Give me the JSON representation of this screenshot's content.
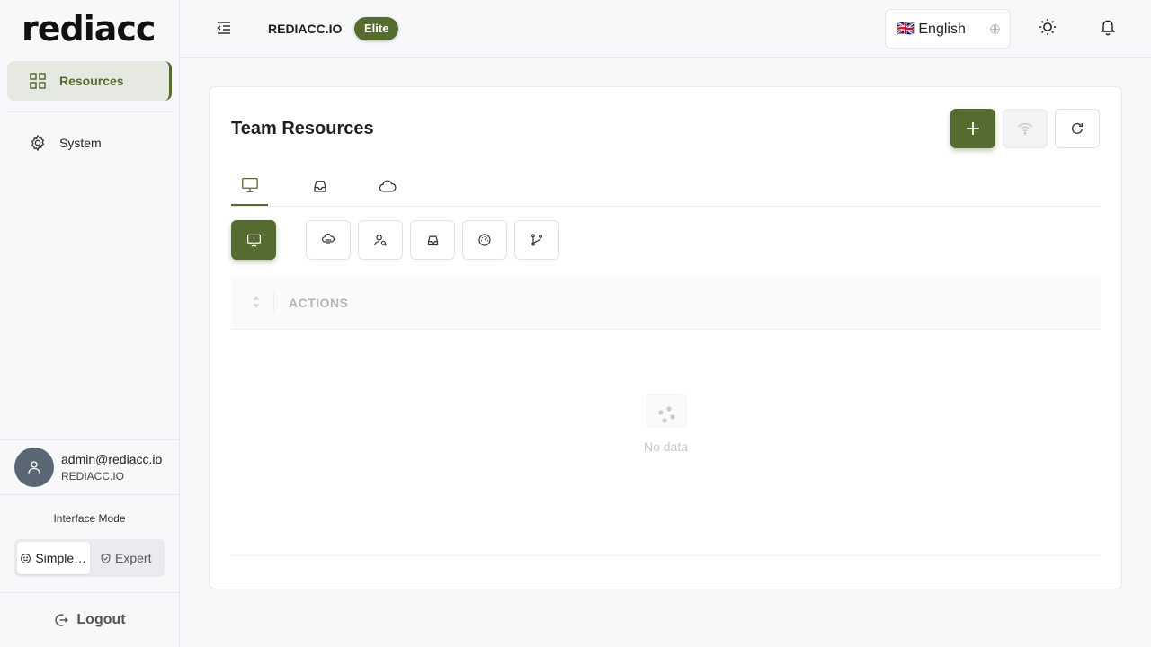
{
  "sidebar": {
    "logo": "rediacc",
    "items": [
      {
        "label": "Resources",
        "icon": "grid-icon",
        "active": true
      },
      {
        "label": "System",
        "icon": "gear-icon",
        "active": false
      }
    ],
    "user": {
      "email": "admin@rediacc.io",
      "org": "REDIACC.IO"
    },
    "interface_mode": {
      "label": "Interface Mode",
      "options": [
        "Simple…",
        "Expert"
      ],
      "selected": "Simple…"
    },
    "logout_label": "Logout"
  },
  "header": {
    "org_name": "REDIACC.IO",
    "plan_badge": "Elite",
    "language": "🇬🇧 English"
  },
  "main": {
    "title": "Team Resources",
    "table": {
      "columns": [
        "ACTIONS"
      ],
      "empty_text": "No data"
    }
  },
  "colors": {
    "accent": "#556b2f",
    "accent_light": "#e6e9e1",
    "border": "#e6e8eb"
  }
}
